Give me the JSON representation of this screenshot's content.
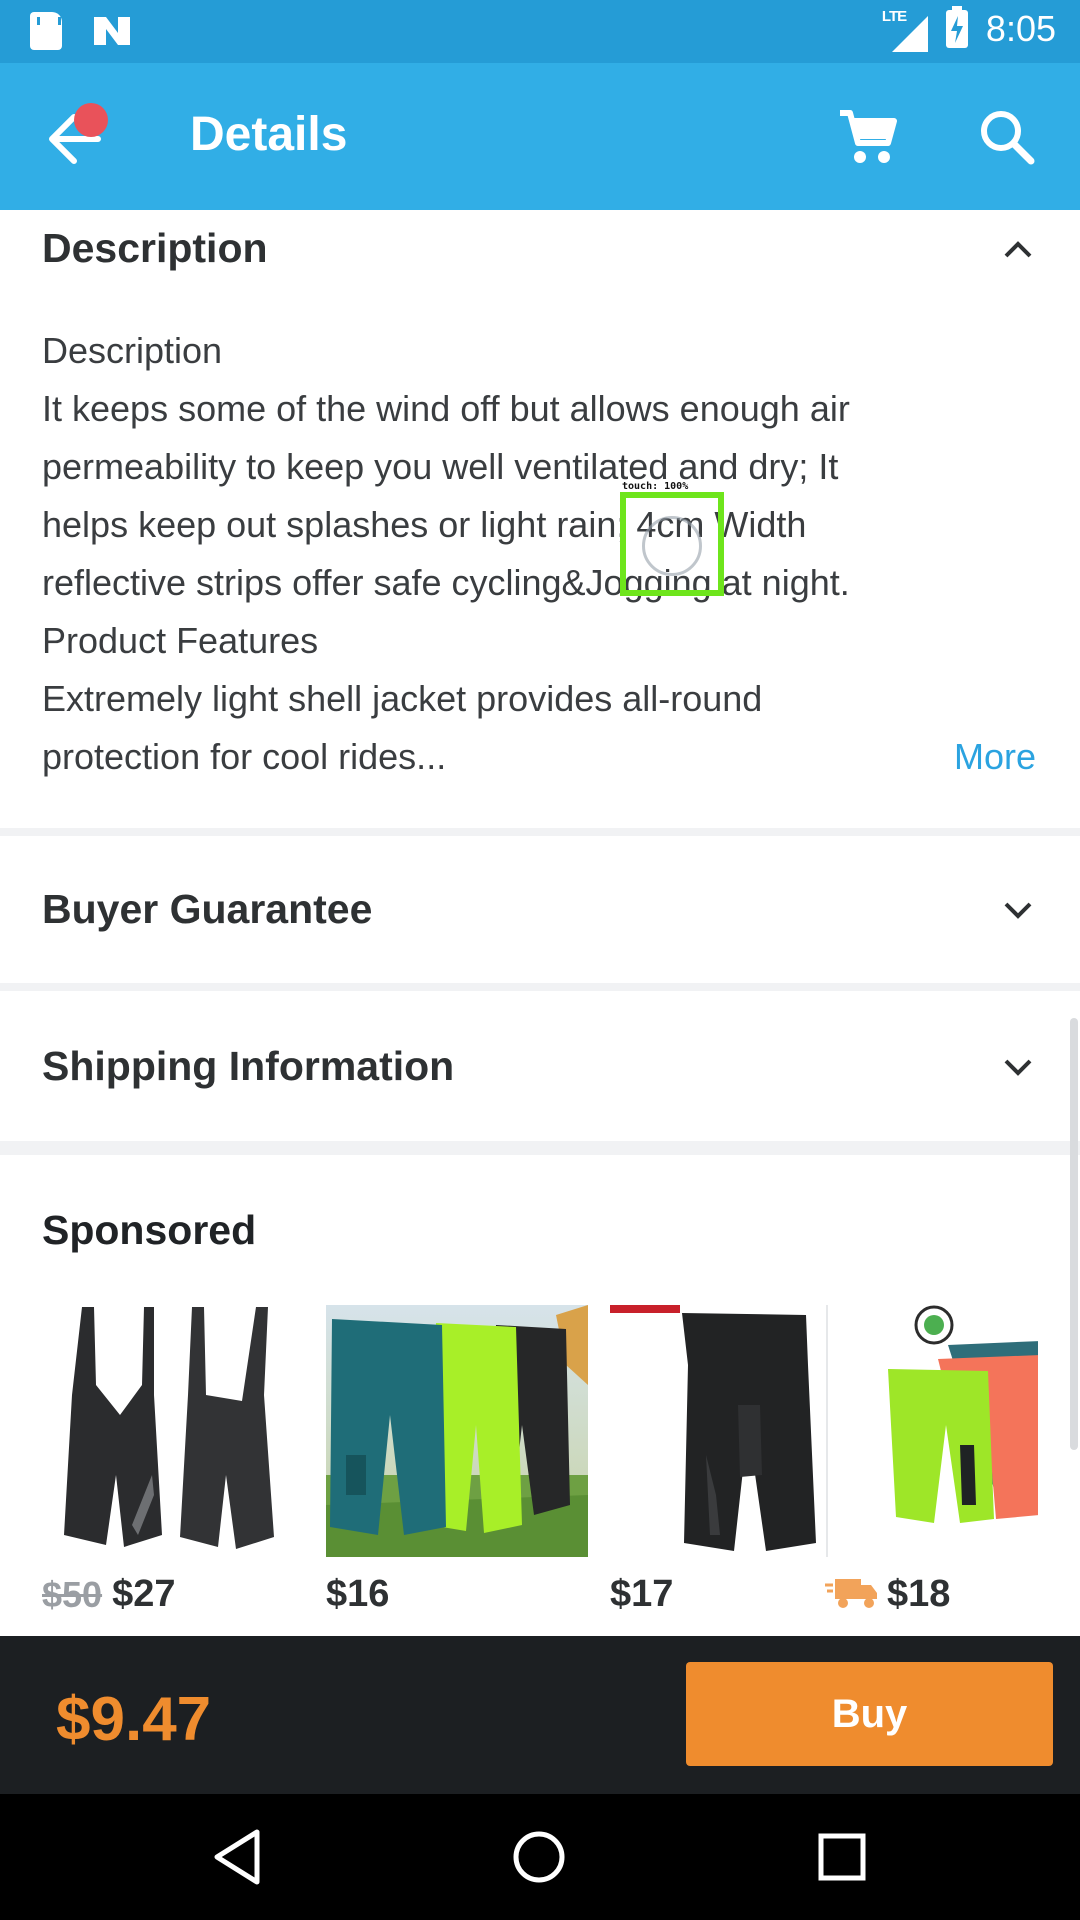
{
  "status_bar": {
    "time": "8:05",
    "network": "LTE",
    "icons": [
      "sd-card-icon",
      "n-notification-icon",
      "lte-signal-icon",
      "battery-charging-icon"
    ]
  },
  "app_bar": {
    "title": "Details",
    "icons": [
      "back-arrow-icon",
      "cart-icon",
      "search-icon"
    ],
    "background": "#31aee6",
    "notification_dot_color": "#e9525a"
  },
  "description": {
    "header": "Description",
    "lines": [
      "Description",
      "It keeps some of the wind off but allows enough air",
      "permeability to keep you well ventilated and dry; It",
      "helps keep out splashes or light rain; 4cm Width",
      "reflective strips offer safe cycling&Jogging at night.",
      "Product Features",
      "Extremely light shell jacket provides all-round",
      "protection for cool rides..."
    ],
    "more_label": "More"
  },
  "sections": {
    "buyer_guarantee": "Buyer Guarantee",
    "shipping_information": "Shipping Information"
  },
  "sponsored": {
    "title": "Sponsored",
    "items": [
      {
        "old_price": "$50",
        "price": "$27",
        "image": "black-bib-shorts"
      },
      {
        "old_price": "",
        "price": "$16",
        "image": "teal-and-green-cycling-shorts-on-grass"
      },
      {
        "old_price": "",
        "price": "$17",
        "image": "black-cargo-shorts"
      },
      {
        "old_price": "",
        "price": "$18",
        "image": "green-and-orange-shorts",
        "badge": "delivery-truck-icon"
      }
    ]
  },
  "touch_indicator": {
    "label": "touch: 100%"
  },
  "buy_bar": {
    "price": "$9.47",
    "buy_label": "Buy",
    "accent": "#ef8c2e"
  },
  "nav_bar": {
    "icons": [
      "back-triangle-icon",
      "home-circle-icon",
      "recents-square-icon"
    ]
  }
}
